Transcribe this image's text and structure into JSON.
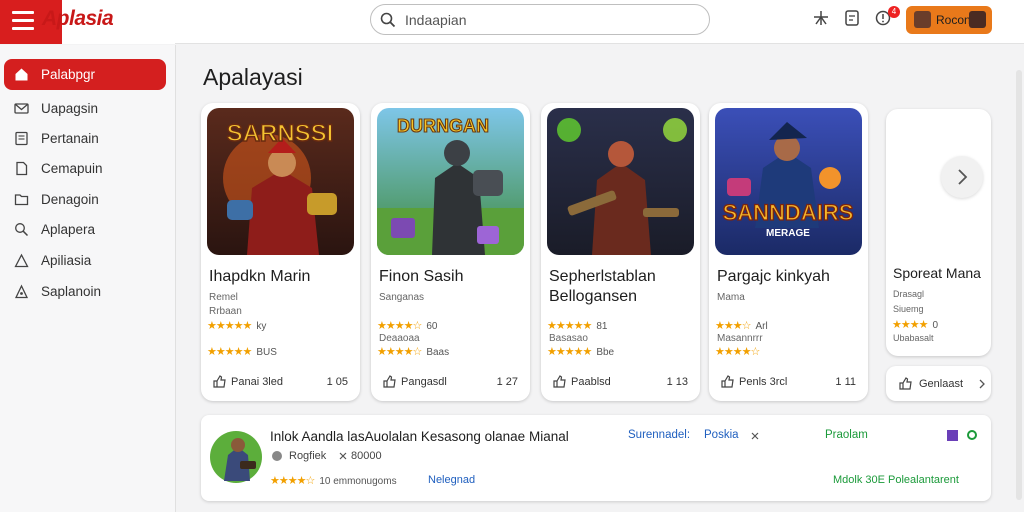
{
  "app": {
    "name": "Aplasia"
  },
  "search": {
    "placeholder": "Indaapian"
  },
  "header": {
    "notification_count": "4",
    "user_label": "Rocone"
  },
  "sidebar": {
    "items": [
      {
        "label": "Palabpgr",
        "icon": "home-icon",
        "active": true
      },
      {
        "label": "Uapagsin",
        "icon": "mail-icon",
        "active": false
      },
      {
        "label": "Pertanain",
        "icon": "document-icon",
        "active": false
      },
      {
        "label": "Cemapuin",
        "icon": "file-icon",
        "active": false
      },
      {
        "label": "Denagoin",
        "icon": "folder-icon",
        "active": false
      },
      {
        "label": "Aplapera",
        "icon": "search-icon",
        "active": false
      },
      {
        "label": "Apiliasia",
        "icon": "chart-icon",
        "active": false
      },
      {
        "label": "Saplanoin",
        "icon": "user-icon",
        "active": false
      }
    ]
  },
  "main": {
    "title": "Apalayasi",
    "cards": [
      {
        "art_title": "SARNSSI",
        "title": "Ihapdkn Marin",
        "sub1": "Remel",
        "sub2": "Rrbaan",
        "rating_text": "ky",
        "rating2_text": "BUS",
        "action": "Panai 3led",
        "count": "1 05"
      },
      {
        "art_title": "DURNGAN",
        "title": "Finon Sasih",
        "sub1": "Sanganas",
        "sub2": "",
        "rating_text": "60",
        "rating2_text": "Baas",
        "action": "Pangasdl",
        "count": "1 27",
        "desc": "Deaaoaa"
      },
      {
        "art_title": "",
        "title": "Sepherlstablan Bellogansen",
        "sub1": "",
        "sub2": "",
        "rating_text": "81",
        "rating2_text": "Bbe",
        "action": "Paablsd",
        "count": "1 13",
        "desc": "Basasao"
      },
      {
        "art_title": "SANNDAIRS",
        "art_sub": "MERAGE",
        "title": "Pargajc kinkyah",
        "sub1": "Mama",
        "sub2": "",
        "rating_text": "Arl",
        "rating2_text": "",
        "action": "Penls 3rcl",
        "count": "1 11",
        "desc": "Masannrrr"
      }
    ],
    "next_card": {
      "title": "Sporeat Mana",
      "sub1": "Drasagl",
      "sub2": "Siuemg",
      "rating_text": "0",
      "desc": "Ubabasalt",
      "action": "Genlaast"
    },
    "list": {
      "title": "Inlok Aandla lasAuolalan Kesasong olanae Mianal",
      "meta": "Rogfiek",
      "meta2": "80000",
      "rating_text": "10 emmonugoms",
      "link": "Nelegnad",
      "right_a": "Surennadel:",
      "right_b": "Poskia",
      "right_c": "Praolam",
      "right_d": "Mdolk 30E Polealantarent"
    }
  },
  "colors": {
    "brand": "#d81e1e",
    "accent_orange": "#e9791a",
    "link_blue": "#1f5fbf",
    "green": "#1b9a3a"
  }
}
